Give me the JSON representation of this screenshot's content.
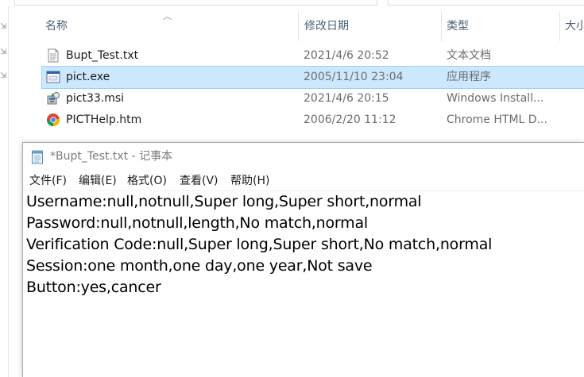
{
  "explorer": {
    "columns": {
      "name": "名称",
      "date": "修改日期",
      "type": "类型",
      "size": "大小"
    },
    "files": [
      {
        "name": "Bupt_Test.txt",
        "date": "2021/4/6 20:52",
        "type": "文本文档",
        "icon": "text-file-icon",
        "selected": false
      },
      {
        "name": "pict.exe",
        "date": "2005/11/10 23:04",
        "type": "应用程序",
        "icon": "exe-file-icon",
        "selected": true
      },
      {
        "name": "pict33.msi",
        "date": "2021/4/6 20:15",
        "type": "Windows Install...",
        "icon": "msi-installer-icon",
        "selected": false
      },
      {
        "name": "PICTHelp.htm",
        "date": "2006/2/20 11:12",
        "type": "Chrome HTML D...",
        "icon": "chrome-icon",
        "selected": false
      }
    ]
  },
  "notepad": {
    "title": "*Bupt_Test.txt - 记事本",
    "menu": [
      {
        "label": "文件(F)"
      },
      {
        "label": "编辑(E)"
      },
      {
        "label": "格式(O)"
      },
      {
        "label": "查看(V)"
      },
      {
        "label": "帮助(H)"
      }
    ],
    "lines": [
      "Username:null,notnull,Super long,Super short,normal",
      "Password:null,notnull,length,No match,normal",
      "Verification Code:null,Super long,Super short,No match,normal",
      "Session:one month,one day,one year,Not save",
      "Button:yes,cancer"
    ]
  },
  "colors": {
    "selection_bg": "#cce8ff",
    "selection_border": "#99d1ff",
    "header_text": "#4c607a",
    "secondary_text": "#6d6d6d"
  }
}
